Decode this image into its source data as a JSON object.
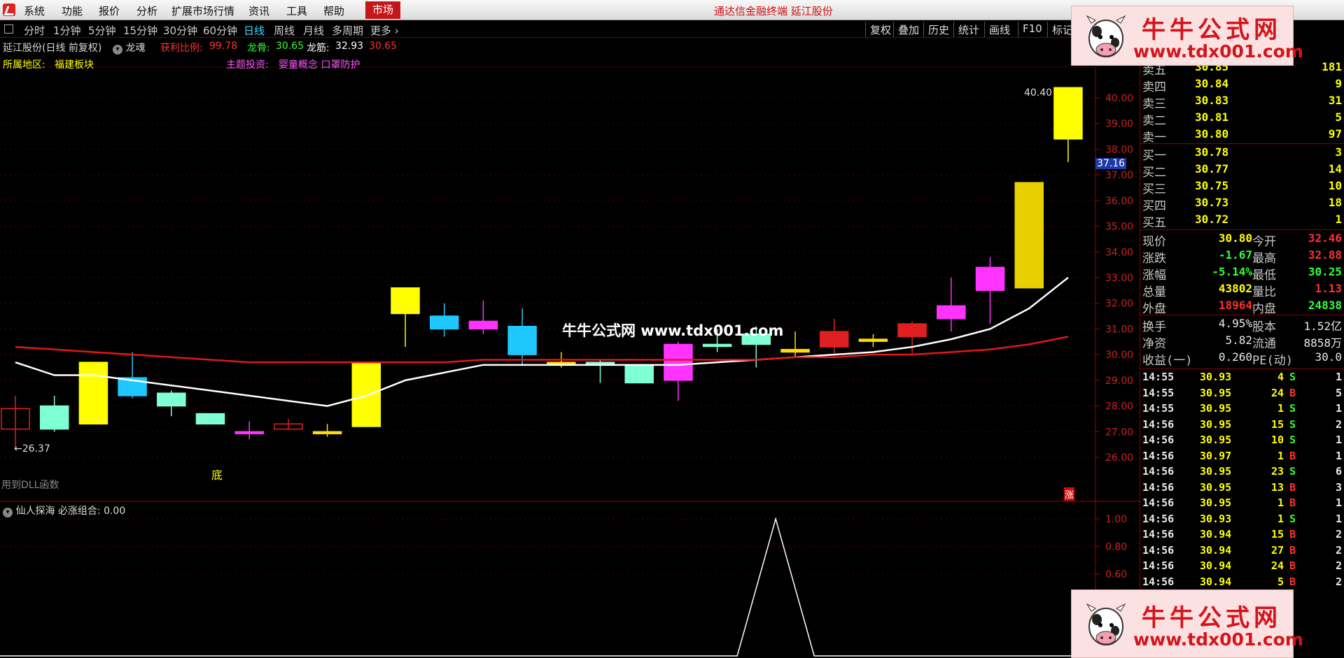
{
  "menu": {
    "items": [
      "系统",
      "功能",
      "报价",
      "分析",
      "扩展市场行情",
      "资讯",
      "工具",
      "帮助"
    ],
    "market": "市场",
    "title": "通达信金融终端  延江股份"
  },
  "toolbar": {
    "periods": [
      "分时",
      "1分钟",
      "5分钟",
      "15分钟",
      "30分钟",
      "60分钟",
      "日线",
      "周线",
      "月线",
      "多周期",
      "更多"
    ],
    "active_period": "日线",
    "right_buttons": [
      "复权",
      "叠加",
      "历史",
      "统计",
      "画线",
      "F10",
      "标记"
    ]
  },
  "info": {
    "stock": "延江股份(日线 前复权)",
    "indicator": "龙魂",
    "profit_label": "获利比例:",
    "profit_value": "99.78",
    "longgu_label": "龙骨:",
    "longgu_value": "30.65",
    "longjin_label": "龙筋:",
    "longjin_value": "32.93",
    "longjin_value2": "30.65",
    "region_label": "所属地区:",
    "region_value": "福建板块",
    "theme_label": "主题投资:",
    "theme_value": "婴童概念 口罩防护",
    "dll_note": "用到DLL函数",
    "bottom_mark": "底",
    "rise_mark": "涨",
    "low_price": "←26.37",
    "high_price": "40.40",
    "current_tag": "37.16"
  },
  "watermark": {
    "title": "牛牛公式网",
    "url": "www.tdx001.com",
    "center_text": "牛牛公式网  www.tdx001.com"
  },
  "sub_indicator": {
    "name": "仙人探海",
    "label": "必涨组合:",
    "value": "0.00",
    "ticks": [
      "1.00",
      "0.80",
      "0.60"
    ]
  },
  "chart_data": {
    "type": "candlestick",
    "y_ticks": [
      "40.00",
      "39.00",
      "38.00",
      "37.00",
      "36.00",
      "35.00",
      "34.00",
      "33.00",
      "32.00",
      "31.00",
      "30.00",
      "29.00",
      "28.00",
      "27.00",
      "26.00"
    ],
    "ylim": [
      25.7,
      40.7
    ],
    "candles": [
      {
        "o": 27.1,
        "h": 28.4,
        "l": 26.37,
        "c": 27.9,
        "col": "#e02020",
        "hollow": true
      },
      {
        "o": 27.1,
        "h": 28.4,
        "l": 27.0,
        "c": 28.0,
        "col": "#7fffd4",
        "hollow": false
      },
      {
        "o": 27.3,
        "h": 29.7,
        "l": 27.3,
        "c": 29.7,
        "col": "#ffff00",
        "hollow": false
      },
      {
        "o": 29.1,
        "h": 30.1,
        "l": 28.3,
        "c": 28.4,
        "col": "#1ec8ff",
        "hollow": false
      },
      {
        "o": 28.0,
        "h": 28.6,
        "l": 27.6,
        "c": 28.5,
        "col": "#7fffd4",
        "hollow": false
      },
      {
        "o": 27.3,
        "h": 27.7,
        "l": 27.3,
        "c": 27.7,
        "col": "#7fffd4",
        "hollow": false
      },
      {
        "o": 27.0,
        "h": 27.4,
        "l": 26.7,
        "c": 27.0,
        "col": "#ff33ff",
        "hollow": false
      },
      {
        "o": 27.1,
        "h": 27.5,
        "l": 27.1,
        "c": 27.3,
        "col": "#e02020",
        "hollow": true
      },
      {
        "o": 27.0,
        "h": 27.3,
        "l": 26.8,
        "c": 27.0,
        "col": "#ffdd00",
        "hollow": false
      },
      {
        "o": 27.2,
        "h": 29.7,
        "l": 27.2,
        "c": 29.7,
        "col": "#ffff00",
        "hollow": false
      },
      {
        "o": 31.6,
        "h": 32.6,
        "l": 30.3,
        "c": 32.6,
        "col": "#ffff00",
        "hollow": false
      },
      {
        "o": 31.5,
        "h": 32.0,
        "l": 30.7,
        "c": 31.0,
        "col": "#1ec8ff",
        "hollow": false
      },
      {
        "o": 31.3,
        "h": 32.1,
        "l": 30.8,
        "c": 31.0,
        "col": "#ff33ff",
        "hollow": false
      },
      {
        "o": 31.1,
        "h": 31.8,
        "l": 29.6,
        "c": 30.0,
        "col": "#1ec8ff",
        "hollow": false
      },
      {
        "o": 29.7,
        "h": 30.1,
        "l": 29.5,
        "c": 29.6,
        "col": "#ffdd00",
        "hollow": false
      },
      {
        "o": 29.7,
        "h": 29.8,
        "l": 28.9,
        "c": 29.7,
        "col": "#7fffd4",
        "hollow": false
      },
      {
        "o": 29.6,
        "h": 29.6,
        "l": 28.9,
        "c": 28.9,
        "col": "#7fffd4",
        "hollow": false
      },
      {
        "o": 29.0,
        "h": 30.5,
        "l": 28.2,
        "c": 30.4,
        "col": "#ff33ff",
        "hollow": false
      },
      {
        "o": 30.4,
        "h": 31.0,
        "l": 30.1,
        "c": 30.4,
        "col": "#7fffd4",
        "hollow": false
      },
      {
        "o": 30.4,
        "h": 31.1,
        "l": 29.5,
        "c": 30.8,
        "col": "#7fffd4",
        "hollow": false
      },
      {
        "o": 30.2,
        "h": 30.9,
        "l": 29.9,
        "c": 30.1,
        "col": "#ffdd00",
        "hollow": false
      },
      {
        "o": 30.3,
        "h": 31.4,
        "l": 29.9,
        "c": 30.9,
        "col": "#e02020",
        "hollow": false
      },
      {
        "o": 30.6,
        "h": 30.8,
        "l": 30.3,
        "c": 30.6,
        "col": "#ffdd00",
        "hollow": false
      },
      {
        "o": 30.7,
        "h": 31.3,
        "l": 30.0,
        "c": 31.2,
        "col": "#e02020",
        "hollow": false
      },
      {
        "o": 31.4,
        "h": 33.0,
        "l": 30.9,
        "c": 31.9,
        "col": "#ff33ff",
        "hollow": false
      },
      {
        "o": 32.5,
        "h": 33.8,
        "l": 31.2,
        "c": 33.4,
        "col": "#ff33ff",
        "hollow": false
      },
      {
        "o": 32.6,
        "h": 36.7,
        "l": 32.6,
        "c": 36.7,
        "col": "#e8d000",
        "hollow": false
      },
      {
        "o": 38.4,
        "h": 40.4,
        "l": 37.5,
        "c": 40.4,
        "col": "#ffff00",
        "hollow": false
      }
    ],
    "white_line": [
      29.7,
      29.2,
      29.2,
      29.0,
      28.8,
      28.6,
      28.4,
      28.2,
      28.0,
      28.4,
      29.0,
      29.3,
      29.6,
      29.6,
      29.6,
      29.6,
      29.6,
      29.6,
      29.7,
      29.8,
      29.9,
      30.0,
      30.1,
      30.3,
      30.6,
      31.0,
      31.8,
      33.0
    ],
    "red_line": [
      30.3,
      30.2,
      30.1,
      30.0,
      29.9,
      29.8,
      29.7,
      29.7,
      29.7,
      29.7,
      29.7,
      29.7,
      29.8,
      29.8,
      29.8,
      29.8,
      29.8,
      29.8,
      29.8,
      29.8,
      29.9,
      29.9,
      30.0,
      30.0,
      30.1,
      30.2,
      30.4,
      30.7
    ],
    "sub_series": [
      0,
      0,
      0,
      0,
      0,
      0,
      0,
      0,
      0,
      0,
      0,
      0,
      0,
      0,
      0,
      0,
      0,
      0,
      0,
      0,
      0,
      0,
      0,
      0,
      0,
      0,
      0,
      0
    ],
    "sub_peak_index": 19.5,
    "sub_peak_value": 1.0
  },
  "quote": {
    "asks": [
      {
        "label": "卖五",
        "price": "30.85",
        "vol": "181"
      },
      {
        "label": "卖四",
        "price": "30.84",
        "vol": "9"
      },
      {
        "label": "卖三",
        "price": "30.83",
        "vol": "31"
      },
      {
        "label": "卖二",
        "price": "30.81",
        "vol": "5"
      },
      {
        "label": "卖一",
        "price": "30.80",
        "vol": "97"
      }
    ],
    "bids": [
      {
        "label": "买一",
        "price": "30.78",
        "vol": "3"
      },
      {
        "label": "买二",
        "price": "30.77",
        "vol": "14"
      },
      {
        "label": "买三",
        "price": "30.75",
        "vol": "10"
      },
      {
        "label": "买四",
        "price": "30.73",
        "vol": "18"
      },
      {
        "label": "买五",
        "price": "30.72",
        "vol": "1"
      }
    ],
    "stats": [
      {
        "l1": "现价",
        "v1": "30.80",
        "c1": "#ffff00",
        "l2": "今开",
        "v2": "32.46",
        "c2": "#ff3030"
      },
      {
        "l1": "涨跌",
        "v1": "-1.67",
        "c1": "#33ff33",
        "l2": "最高",
        "v2": "32.88",
        "c2": "#ff3030"
      },
      {
        "l1": "涨幅",
        "v1": "-5.14%",
        "c1": "#33ff33",
        "l2": "最低",
        "v2": "30.25",
        "c2": "#33ff33"
      },
      {
        "l1": "总量",
        "v1": "43802",
        "c1": "#ffff00",
        "l2": "量比",
        "v2": "1.13",
        "c2": "#ff3030"
      },
      {
        "l1": "外盘",
        "v1": "18964",
        "c1": "#ff3030",
        "l2": "内盘",
        "v2": "24838",
        "c2": "#33ff33"
      }
    ],
    "fund": [
      {
        "l1": "换手",
        "v1": "4.95%",
        "l2": "股本",
        "v2": "1.52亿"
      },
      {
        "l1": "净资",
        "v1": "5.82",
        "l2": "流通",
        "v2": "8858万"
      },
      {
        "l1": "收益(一)",
        "v1": "0.260",
        "l2": "PE(动)",
        "v2": "30.0"
      }
    ],
    "ticks": [
      {
        "t": "14:55",
        "p": "30.93",
        "v": "4",
        "d": "S",
        "n": "1"
      },
      {
        "t": "14:55",
        "p": "30.95",
        "v": "24",
        "d": "B",
        "n": "5"
      },
      {
        "t": "14:55",
        "p": "30.95",
        "v": "1",
        "d": "S",
        "n": "1"
      },
      {
        "t": "14:56",
        "p": "30.95",
        "v": "15",
        "d": "S",
        "n": "2"
      },
      {
        "t": "14:56",
        "p": "30.95",
        "v": "10",
        "d": "S",
        "n": "1"
      },
      {
        "t": "14:56",
        "p": "30.97",
        "v": "1",
        "d": "B",
        "n": "1"
      },
      {
        "t": "14:56",
        "p": "30.95",
        "v": "23",
        "d": "S",
        "n": "6"
      },
      {
        "t": "14:56",
        "p": "30.95",
        "v": "13",
        "d": "B",
        "n": "3"
      },
      {
        "t": "14:56",
        "p": "30.95",
        "v": "1",
        "d": "B",
        "n": "1"
      },
      {
        "t": "14:56",
        "p": "30.93",
        "v": "1",
        "d": "S",
        "n": "1"
      },
      {
        "t": "14:56",
        "p": "30.94",
        "v": "15",
        "d": "B",
        "n": "2"
      },
      {
        "t": "14:56",
        "p": "30.94",
        "v": "27",
        "d": "B",
        "n": "2"
      },
      {
        "t": "14:56",
        "p": "30.94",
        "v": "24",
        "d": "B",
        "n": "2"
      },
      {
        "t": "14:56",
        "p": "30.94",
        "v": "5",
        "d": "B",
        "n": "2"
      }
    ]
  }
}
